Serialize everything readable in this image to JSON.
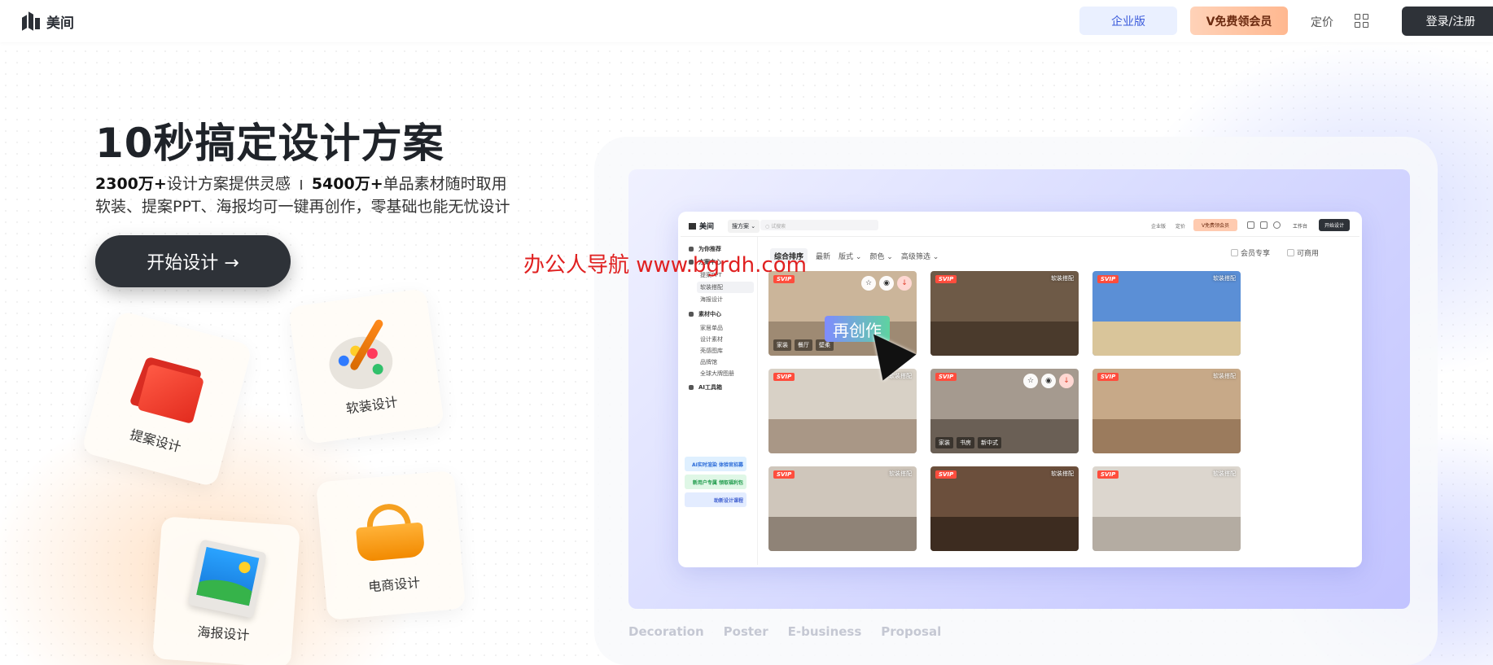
{
  "header": {
    "logo_text": "美间",
    "enterprise_label": "企业版",
    "vip_label": "V免费领会员",
    "pricing_label": "定价",
    "login_label": "登录/注册"
  },
  "hero": {
    "title": "10秒搞定设计方案",
    "stat1_value": "2300万+",
    "stat1_text": "设计方案提供灵感",
    "stat2_value": "5400万+",
    "stat2_text": "单品素材随时取用",
    "subtitle": "软装、提案PPT、海报均可一键再创作，零基础也能无忧设计",
    "start_button": "开始设计 →"
  },
  "cards": {
    "proposal": "提案设计",
    "soft": "软装设计",
    "ecommerce": "电商设计",
    "poster": "海报设计"
  },
  "showcase": {
    "tags": [
      "Decoration",
      "Poster",
      "E-business",
      "Proposal"
    ],
    "recreate_label": "再创作",
    "mock": {
      "logo": "美间",
      "select": "搜方案 ⌄",
      "search_placeholder": "○ 试搜索",
      "enterprise": "企业版",
      "pricing": "定价",
      "vip": "V免费领会员",
      "workspace": "工作台",
      "start": "开始设计",
      "sidebar": {
        "recommend": "为你推荐",
        "scheme": "方案中心",
        "ppt": "提案PPT",
        "soft": "软装搭配",
        "poster": "海报设计",
        "material": "素材中心",
        "items": [
          "家居单品",
          "设计素材",
          "壳感图库",
          "品牌馆",
          "全球大牌图册"
        ],
        "ai": "AI工具箱",
        "banner1": "AI实时渲染 体验官招募",
        "banner2": "新用户专属 领取福利包",
        "banner3": "助新设计课程"
      },
      "filters": [
        "综合排序",
        "最新",
        "版式 ⌄",
        "颜色 ⌄",
        "高级筛选 ⌄"
      ],
      "member_only": "会员专享",
      "commercial": "可商用",
      "tiles": [
        {
          "badge": "SVIP",
          "tag": "",
          "chips": [
            "家装",
            "餐厅",
            "壁柔"
          ],
          "bg": "#cbb59a",
          "floor": "#9e8a73"
        },
        {
          "badge": "SVIP",
          "tag": "软装搭配",
          "chips": [],
          "bg": "#6e5a47",
          "floor": "#4a3a2c"
        },
        {
          "badge": "SVIP",
          "tag": "软装搭配",
          "chips": [],
          "bg": "#5b8fd6",
          "floor": "#d9c59a"
        },
        {
          "badge": "SVIP",
          "tag": "软装搭配",
          "chips": [],
          "bg": "#d8d1c6",
          "floor": "#a99786"
        },
        {
          "badge": "SVIP",
          "tag": "",
          "chips": [
            "家装",
            "书房",
            "新中式"
          ],
          "bg": "#a59a8f",
          "floor": "#6a5f55"
        },
        {
          "badge": "SVIP",
          "tag": "软装搭配",
          "chips": [],
          "bg": "#c7a988",
          "floor": "#9b7b5d"
        },
        {
          "badge": "SVIP",
          "tag": "软装搭配",
          "chips": [],
          "bg": "#cfc6bb",
          "floor": "#8f8377"
        },
        {
          "badge": "SVIP",
          "tag": "软装搭配",
          "chips": [],
          "bg": "#6b4f3c",
          "floor": "#3d2c20"
        },
        {
          "badge": "SVIP",
          "tag": "软装搭配",
          "chips": [],
          "bg": "#dcd6ce",
          "floor": "#b4aca2"
        }
      ]
    }
  },
  "watermark": "办公人导航 www.bgrdh.com",
  "colors": {
    "dark": "#2e3238",
    "enterprise_bg": "#eaf0ff",
    "vip_bg": "#ffb890",
    "svip": "#ff4d3d"
  }
}
